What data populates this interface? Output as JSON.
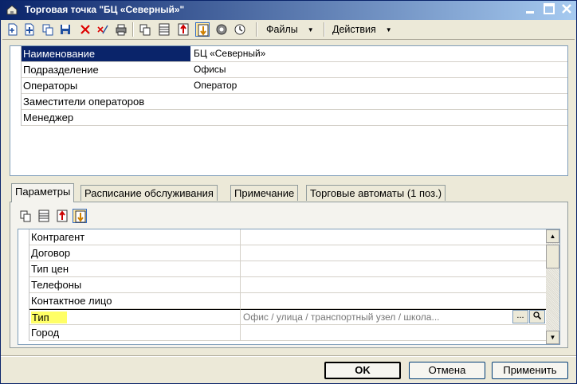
{
  "window": {
    "title": "Торговая точка \"БЦ «Северный»\""
  },
  "toolbar": {
    "menus": [
      {
        "label": "Файлы"
      },
      {
        "label": "Действия"
      }
    ]
  },
  "main_grid": {
    "rows": [
      {
        "name": "Наименование",
        "value": "БЦ «Северный»"
      },
      {
        "name": "Подразделение",
        "value": "Офисы"
      },
      {
        "name": "Операторы",
        "value": "Оператор"
      },
      {
        "name": "Заместители операторов",
        "value": ""
      },
      {
        "name": "Менеджер",
        "value": ""
      }
    ]
  },
  "tabs": [
    {
      "label": "Параметры"
    },
    {
      "label": "Расписание обслуживания"
    },
    {
      "label": "Примечание"
    },
    {
      "label": "Торговые автоматы (1 поз.)"
    }
  ],
  "params_grid": {
    "rows": [
      {
        "name": "Контрагент",
        "value": ""
      },
      {
        "name": "Договор",
        "value": ""
      },
      {
        "name": "Тип цен",
        "value": ""
      },
      {
        "name": "Телефоны",
        "value": ""
      },
      {
        "name": "Контактное лицо",
        "value": ""
      },
      {
        "name": "Тип",
        "value": "Офис / улица / транспортный узел / школа..."
      },
      {
        "name": "Город",
        "value": ""
      }
    ],
    "edit_buttons": {
      "select": "...",
      "search": "🔍"
    }
  },
  "buttons": {
    "ok": "OK",
    "cancel": "Отмена",
    "apply": "Применить"
  },
  "colors": {
    "selection": "#0a246a",
    "highlight": "#ffff66",
    "title_gradient_start": "#0a246a",
    "title_gradient_end": "#a6caf0"
  }
}
